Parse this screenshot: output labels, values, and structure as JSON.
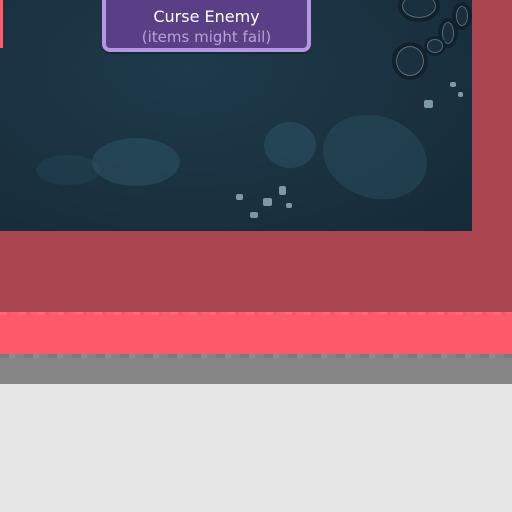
{
  "action_button": {
    "title": "Curse Enemy",
    "subtitle": "(items might fail)"
  },
  "colors": {
    "game_background": "#1a3140",
    "button_fill": "#5a3e86",
    "button_border": "#b596e4",
    "button_subtitle": "#b7a2d8",
    "frame_panel": "#a9454f",
    "frame_trim": "#ff5a6b",
    "frame_shadow": "#868686",
    "floor": "#e6e6e6"
  },
  "icons": {
    "chain": "chain-icon",
    "rubble": "rubble-icon"
  }
}
